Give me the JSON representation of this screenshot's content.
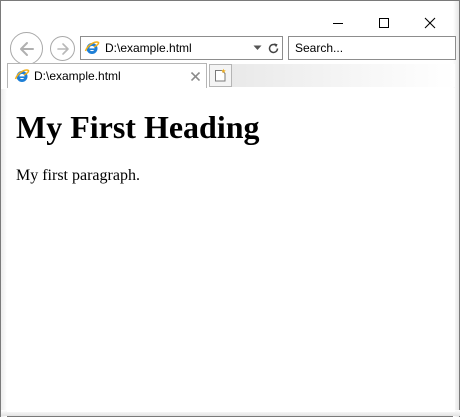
{
  "window": {
    "caption": {
      "minimize_icon": "minimize-icon",
      "maximize_icon": "maximize-icon",
      "close_icon": "close-icon"
    }
  },
  "navigation": {
    "back_icon": "back-arrow-icon",
    "forward_icon": "forward-arrow-icon",
    "address": {
      "favicon": "ie-favicon-icon",
      "url": "D:\\example.html",
      "dropdown_icon": "chevron-down-icon",
      "refresh_icon": "refresh-icon"
    },
    "search": {
      "placeholder": "Search..."
    }
  },
  "tabs": [
    {
      "title": "D:\\example.html",
      "favicon": "ie-favicon-icon",
      "close_icon": "close-icon",
      "active": true
    }
  ],
  "new_tab_icon": "new-tab-icon",
  "page": {
    "heading": "My First Heading",
    "paragraph": "My first paragraph."
  },
  "colors": {
    "accent": "#1e7fd6",
    "ie_orange": "#f2b01c",
    "border": "#8d8d8d"
  }
}
